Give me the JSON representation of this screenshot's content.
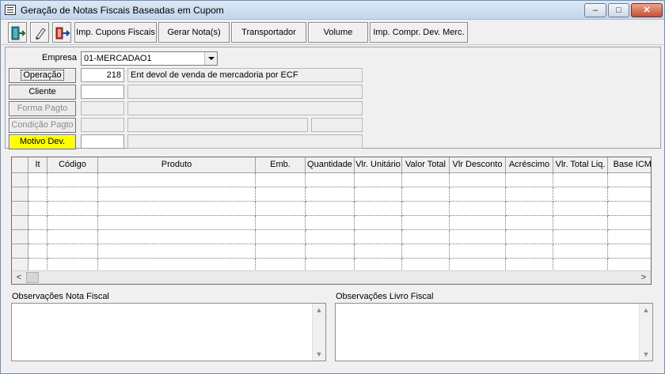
{
  "window": {
    "title": "Geração de Notas Fiscais Baseadas em Cupom",
    "controls": {
      "minimize": "–",
      "maximize": "□",
      "close": "✕"
    }
  },
  "toolbar": {
    "icons": [
      "exit-door-icon",
      "eraser-icon",
      "export-arrow-icon"
    ],
    "buttons": [
      "Imp. Cupons Fiscais",
      "Gerar Nota(s)",
      "Transportador",
      "Volume",
      "Imp. Compr. Dev. Merc."
    ]
  },
  "form": {
    "empresa_label": "Empresa",
    "empresa_value": "01-MERCADAO1",
    "operacao_label": "Operação",
    "operacao_code": "218",
    "operacao_desc": "Ent devol de venda de mercadoria por ECF",
    "cliente_label": "Cliente",
    "cliente_code": "",
    "cliente_desc": "",
    "forma_pagto_label": "Forma Pagto",
    "forma_pagto_code": "",
    "forma_pagto_desc": "",
    "condicao_pagto_label": "Condição Pagto",
    "condicao_pagto_code": "",
    "condicao_pagto_desc": "",
    "condicao_pagto_extra": "",
    "motivo_dev_label": "Motivo Dev.",
    "motivo_dev_code": "",
    "motivo_dev_desc": ""
  },
  "grid": {
    "columns": [
      "It",
      "Código",
      "Produto",
      "Emb.",
      "Quantidade",
      "Vlr. Unitário",
      "Valor Total",
      "Vlr Desconto",
      "Acréscimo",
      "Vlr. Total Liq.",
      "Base ICMS"
    ],
    "rows": [
      [],
      [],
      [],
      [],
      [],
      [],
      []
    ],
    "scroll_left": "<",
    "scroll_right": ">"
  },
  "memos": {
    "nota_fiscal_label": "Observações Nota Fiscal",
    "nota_fiscal_text": "",
    "livro_fiscal_label": "Observações Livro Fiscal",
    "livro_fiscal_text": "",
    "scroll_up": "▲",
    "scroll_down": "▼"
  },
  "colors": {
    "motivo_dev_button": "#ffff00",
    "window_border": "#6f8fb1",
    "close_button": "#c74f34"
  }
}
